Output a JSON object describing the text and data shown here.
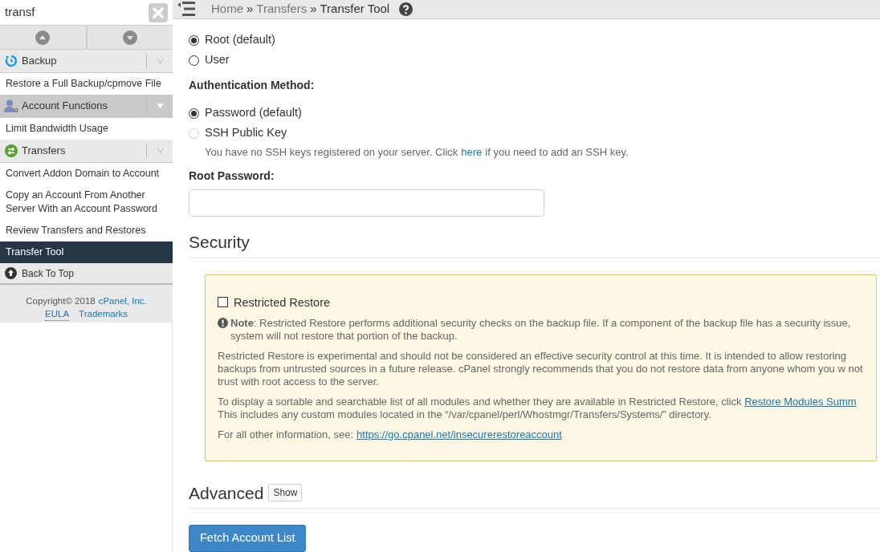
{
  "sidebar": {
    "search": {
      "value": "transf"
    },
    "items": [
      {
        "kind": "section",
        "label": "Backup",
        "highlighted": false
      },
      {
        "kind": "link",
        "label": "Restore a Full Backup/cpmove File",
        "selected": false
      },
      {
        "kind": "section",
        "label": "Account Functions",
        "highlighted": true
      },
      {
        "kind": "link",
        "label": "Limit Bandwidth Usage",
        "selected": false
      },
      {
        "kind": "section",
        "label": "Transfers",
        "highlighted": false
      },
      {
        "kind": "link",
        "label": "Convert Addon Domain to Account",
        "selected": false
      },
      {
        "kind": "link",
        "label": "Copy an Account From Another Server With an Account Password",
        "selected": false
      },
      {
        "kind": "link",
        "label": "Review Transfers and Restores",
        "selected": false
      },
      {
        "kind": "link",
        "label": "Transfer Tool",
        "selected": true
      },
      {
        "kind": "top",
        "label": "Back To Top"
      }
    ],
    "footer": {
      "copyright": "Copyright© 2018",
      "company": "cPanel, Inc.",
      "links": [
        "EULA",
        "Trademarks"
      ]
    }
  },
  "breadcrumb": [
    {
      "label": "Home",
      "current": false
    },
    {
      "label": "Transfers",
      "current": false
    },
    {
      "label": "Transfer Tool",
      "current": true
    }
  ],
  "breadcrumb_separator": "»",
  "user_radios": [
    {
      "label": "Root (default)",
      "selected": true,
      "disabled": false
    },
    {
      "label": "User",
      "selected": false,
      "disabled": false
    }
  ],
  "auth_heading": "Authentication Method:",
  "auth_radios": [
    {
      "label": "Password (default)",
      "selected": true,
      "disabled": false
    },
    {
      "label": "SSH Public Key",
      "selected": false,
      "disabled": true
    }
  ],
  "ssh_hint": {
    "before": "You have no SSH keys registered on your server. Click",
    "link": "here",
    "after": "if you need to add an SSH key."
  },
  "password_label": "Root Password:",
  "security": {
    "title": "Security",
    "checkbox": {
      "label": "Restricted Restore",
      "checked": false
    },
    "note": "**Note**: Restricted Restore performs additional security checks on the backup file. If a component of the backup file has a security issue, system will not restore that portion of the backup.",
    "paragraph": "Restricted Restore is experimental and should not be considered an effective security control at this time. It is intended to allow restoring backups from untrusted sources in a future release. cPanel strongly recommends that you do not restore data from anyone whom you w not trust with root access to the server.",
    "modules": {
      "before": "To display a sortable and searchable list of all modules and whether they are available in Restricted Restore, click",
      "link": "Restore Modules Summ",
      "after": "This includes any custom modules located in the “/var/cpanel/perl/Whostmgr/Transfers/Systems/” directory."
    },
    "info": {
      "before": "For all other information, see:",
      "link": "https://go.cpanel.net/insecurerestoreaccount"
    }
  },
  "advanced": {
    "title": "Advanced",
    "toggle": "Show"
  },
  "submit": "Fetch Account List"
}
